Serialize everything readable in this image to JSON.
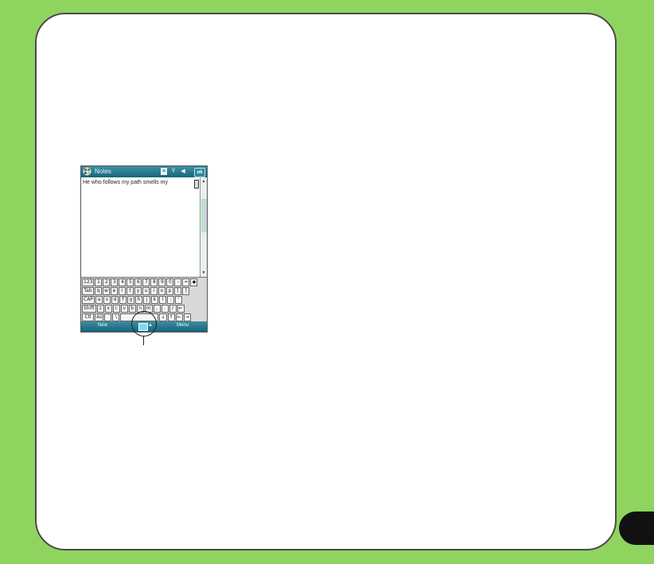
{
  "device": {
    "app_title": "Notes",
    "titlebar_icons": [
      "windows-start-icon",
      "keyboard-indicator-icon",
      "signal-icon",
      "speaker-icon"
    ],
    "ok_label": "ok",
    "note_text": "He who follows my path smells my",
    "keyboard": {
      "row1": [
        "123",
        "1",
        "2",
        "3",
        "4",
        "5",
        "6",
        "7",
        "8",
        "9",
        "0",
        "-",
        "=",
        "◆"
      ],
      "row2": [
        "Tab",
        "q",
        "w",
        "e",
        "r",
        "t",
        "y",
        "u",
        "i",
        "o",
        "p",
        "[",
        "]"
      ],
      "row3": [
        "CAP",
        "a",
        "s",
        "d",
        "f",
        "g",
        "h",
        "j",
        "k",
        "l",
        ";",
        "'"
      ],
      "row4": [
        "Shift",
        "z",
        "x",
        "c",
        "v",
        "b",
        "n",
        "m",
        ",",
        ".",
        "/",
        "↵"
      ],
      "row5": [
        "Ctl",
        "áü",
        "`",
        "\\",
        " ",
        "↓",
        "↑",
        "←",
        "→"
      ]
    },
    "menu_left": "New",
    "menu_right": "Menu"
  },
  "colors": {
    "page_background": "#8fd45f",
    "titlebar": "#17657c"
  }
}
